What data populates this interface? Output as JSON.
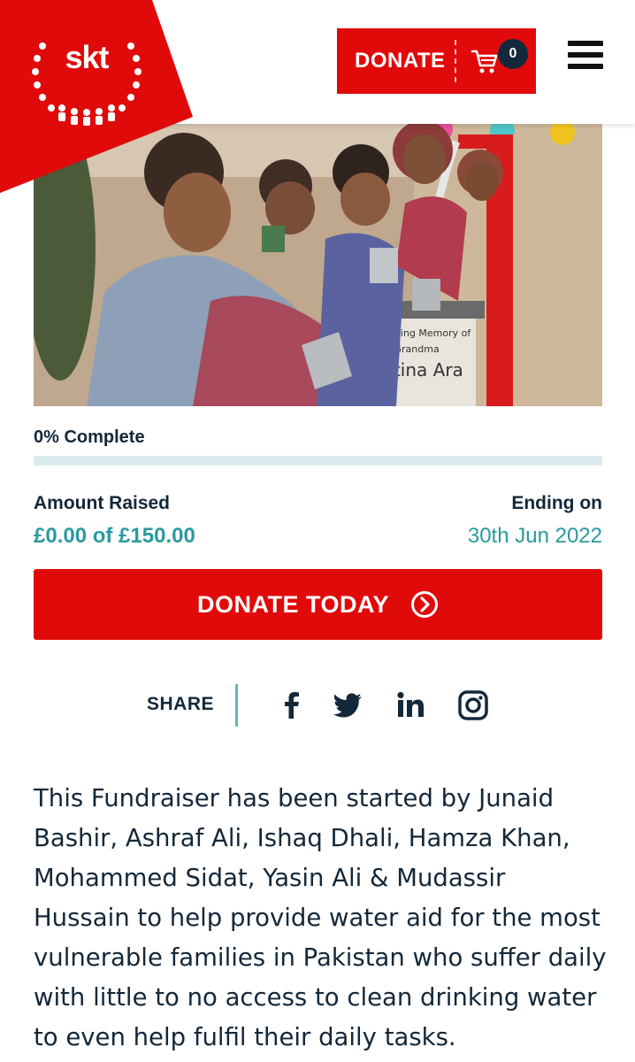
{
  "header": {
    "logo_text": "skt",
    "donate_label": "DONATE",
    "cart_count": "0",
    "brand_color": "#e10a0a",
    "icons": [
      "laurel-logo",
      "cart-icon",
      "hamburger-menu-icon"
    ]
  },
  "progress": {
    "label": "0% Complete",
    "fraction": 0
  },
  "stats": {
    "amount_label": "Amount Raised",
    "amount_value": "£0.00 of £150.00",
    "ending_label": "Ending on",
    "ending_value": "30th Jun 2022",
    "accent_color": "#2a9aa0"
  },
  "cta": {
    "label": "DONATE TODAY",
    "icon": "chevron-circle-right-icon"
  },
  "share": {
    "label": "SHARE",
    "networks": [
      "facebook-icon",
      "twitter-icon",
      "linkedin-icon",
      "instagram-icon"
    ]
  },
  "description": "This Fundraiser has been started by Junaid Bashir, Ashraf Ali, Ishaq Dhali, Hamza Khan, Mohammed Sidat, Yasin Ali & Mudassir Hussain to help provide water aid for the most vulnerable families in Pakistan who suffer daily with little to no access to clean drinking water to even help fulfil their daily tasks."
}
